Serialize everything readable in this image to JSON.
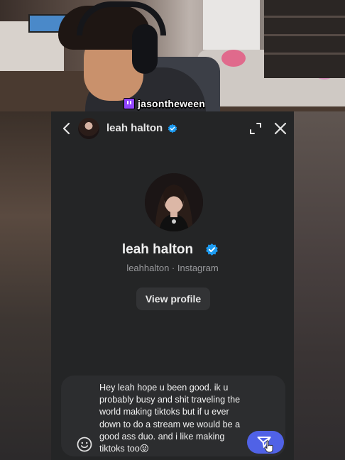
{
  "stream": {
    "handle": "jasontheween",
    "platform_icon": "twitch-icon"
  },
  "chat": {
    "header": {
      "name": "leah halton",
      "back_icon": "chevron-left-icon",
      "expand_icon": "expand-icon",
      "close_icon": "close-icon"
    },
    "profile": {
      "name": "leah halton",
      "subtitle": "leahhalton · Instagram",
      "view_profile_label": "View profile",
      "verified_color": "#1d9bf0"
    },
    "composer": {
      "message": "Hey leah hope u been good. ik u probably busy and shit traveling the world making tiktoks but if u ever down to do a stream we would be a good ass duo. and i like making tiktoks too",
      "emoji": "😝",
      "send_color": "#5062e6"
    }
  }
}
